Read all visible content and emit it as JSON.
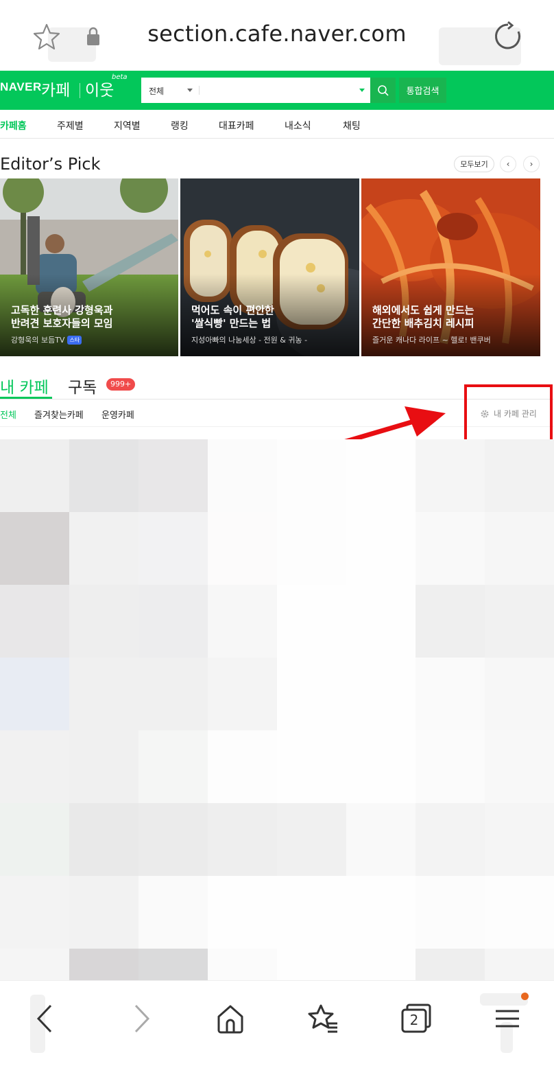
{
  "browser": {
    "url": "section.cafe.naver.com",
    "tab_count": "2"
  },
  "header": {
    "logo": "NAVER",
    "service": "카페",
    "sub_service": "이웃",
    "sub_badge": "beta",
    "search_scope": "전체",
    "search_value": "",
    "search_all_button": "통합검색",
    "brand_color": "#03c75a"
  },
  "nav": {
    "tabs": [
      "카페홈",
      "주제별",
      "지역별",
      "랭킹",
      "대표카페",
      "내소식",
      "채팅"
    ],
    "active": "카페홈"
  },
  "editors_pick": {
    "title": "Editor’s Pick",
    "view_all": "모두보기",
    "prev": "‹",
    "next": "›",
    "cards": [
      {
        "title": "고독한 훈련사 강형욱과\n반려견 보호자들의 모임",
        "source": "강형욱의 보듬TV",
        "badge": "스타"
      },
      {
        "title": "먹어도 속이 편안한\n'쌀식빵' 만드는 법",
        "source": "지성아빠의 나눔세상 - 전원 & 귀농 -"
      },
      {
        "title": "해외에서도 쉽게 만드는\n간단한 배추김치 레시피",
        "source": "즐거운 캐나다 라이프 ~ 헬로! 밴쿠버"
      }
    ]
  },
  "my_cafe": {
    "tab_my": "내 카페",
    "tab_subscribe": "구독",
    "subscribe_badge": "999+",
    "subtabs": [
      "전체",
      "즐겨찾는카페",
      "운영카페"
    ],
    "manage": "내 카페 관리"
  },
  "annotation": {
    "color": "#e80e12"
  }
}
